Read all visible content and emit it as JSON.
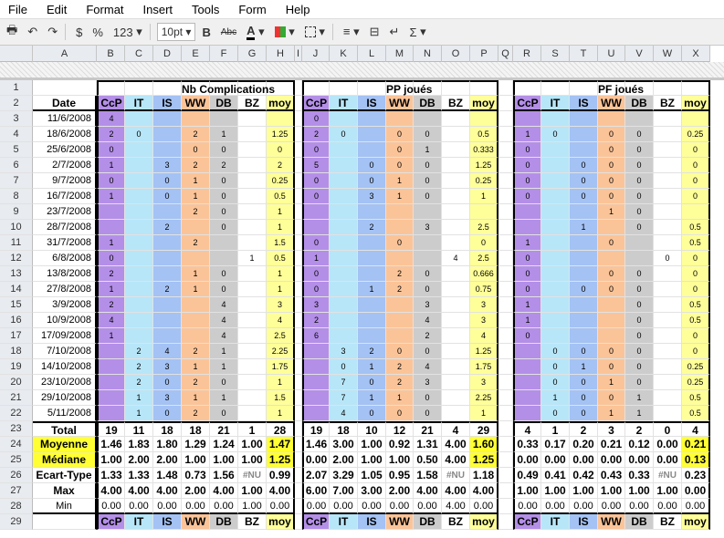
{
  "menu": [
    "File",
    "Edit",
    "Format",
    "Insert",
    "Tools",
    "Form",
    "Help"
  ],
  "toolbar": {
    "currency": "$",
    "percent": "%",
    "number_format": "123",
    "font_size": "10pt",
    "bold": "B",
    "strike": "Abc",
    "sigma": "Σ"
  },
  "columns": [
    "",
    "A",
    "B",
    "C",
    "D",
    "E",
    "F",
    "G",
    "H",
    "I",
    "J",
    "K",
    "L",
    "M",
    "N",
    "O",
    "P",
    "Q",
    "R",
    "S",
    "T",
    "U",
    "V",
    "W",
    "X"
  ],
  "sections": {
    "complications": "Nb Complications",
    "pp": "PP joués",
    "pf": "PF joués"
  },
  "headers": [
    "CcP",
    "IT",
    "IS",
    "WW",
    "DB",
    "BZ",
    "moy"
  ],
  "date_label": "Date",
  "rows": [
    {
      "n": "3",
      "date": "11/6/2008",
      "a": [
        "4",
        "",
        "",
        "",
        "",
        "",
        ""
      ],
      "b": [
        "0",
        "",
        "",
        "",
        "",
        "",
        ""
      ],
      "c": [
        "",
        "",
        "",
        "",
        "",
        "",
        ""
      ]
    },
    {
      "n": "4",
      "date": "18/6/2008",
      "a": [
        "2",
        "0",
        "",
        "2",
        "1",
        "",
        "1.25"
      ],
      "b": [
        "2",
        "0",
        "",
        "0",
        "0",
        "",
        "0.5"
      ],
      "c": [
        "1",
        "0",
        "",
        "0",
        "0",
        "",
        "0.25"
      ]
    },
    {
      "n": "5",
      "date": "25/6/2008",
      "a": [
        "0",
        "",
        "",
        "0",
        "0",
        "",
        "0"
      ],
      "b": [
        "0",
        "",
        "",
        "0",
        "1",
        "",
        "0.333"
      ],
      "c": [
        "0",
        "",
        "",
        "0",
        "0",
        "",
        "0"
      ]
    },
    {
      "n": "6",
      "date": "2/7/2008",
      "a": [
        "1",
        "",
        "3",
        "2",
        "2",
        "",
        "2"
      ],
      "b": [
        "5",
        "",
        "0",
        "0",
        "0",
        "",
        "1.25"
      ],
      "c": [
        "0",
        "",
        "0",
        "0",
        "0",
        "",
        "0"
      ]
    },
    {
      "n": "7",
      "date": "9/7/2008",
      "a": [
        "0",
        "",
        "0",
        "1",
        "0",
        "",
        "0.25"
      ],
      "b": [
        "0",
        "",
        "0",
        "1",
        "0",
        "",
        "0.25"
      ],
      "c": [
        "0",
        "",
        "0",
        "0",
        "0",
        "",
        "0"
      ]
    },
    {
      "n": "8",
      "date": "16/7/2008",
      "a": [
        "1",
        "",
        "0",
        "1",
        "0",
        "",
        "0.5"
      ],
      "b": [
        "0",
        "",
        "3",
        "1",
        "0",
        "",
        "1"
      ],
      "c": [
        "0",
        "",
        "0",
        "0",
        "0",
        "",
        "0"
      ]
    },
    {
      "n": "9",
      "date": "23/7/2008",
      "a": [
        "",
        "",
        "",
        "2",
        "0",
        "",
        "1"
      ],
      "b": [
        "",
        "",
        "",
        "",
        "",
        "",
        ""
      ],
      "c": [
        "",
        "",
        "",
        "1",
        "0",
        "",
        ""
      ]
    },
    {
      "n": "10",
      "date": "28/7/2008",
      "a": [
        "",
        "",
        "2",
        "",
        "0",
        "",
        "1"
      ],
      "b": [
        "",
        "",
        "2",
        "",
        "3",
        "",
        "2.5"
      ],
      "c": [
        "",
        "",
        "1",
        "",
        "0",
        "",
        "0.5"
      ]
    },
    {
      "n": "11",
      "date": "31/7/2008",
      "a": [
        "1",
        "",
        "",
        "2",
        "",
        "",
        "1.5"
      ],
      "b": [
        "0",
        "",
        "",
        "0",
        "",
        "",
        "0"
      ],
      "c": [
        "1",
        "",
        "",
        "0",
        "",
        "",
        "0.5"
      ]
    },
    {
      "n": "12",
      "date": "6/8/2008",
      "a": [
        "0",
        "",
        "",
        "",
        "",
        "1",
        "0.5"
      ],
      "b": [
        "1",
        "",
        "",
        "",
        "",
        "4",
        "2.5"
      ],
      "c": [
        "0",
        "",
        "",
        "",
        "",
        "0",
        "0"
      ]
    },
    {
      "n": "13",
      "date": "13/8/2008",
      "a": [
        "2",
        "",
        "",
        "1",
        "0",
        "",
        "1"
      ],
      "b": [
        "0",
        "",
        "",
        "2",
        "0",
        "",
        "0.666"
      ],
      "c": [
        "0",
        "",
        "",
        "0",
        "0",
        "",
        "0"
      ]
    },
    {
      "n": "14",
      "date": "27/8/2008",
      "a": [
        "1",
        "",
        "2",
        "1",
        "0",
        "",
        "1"
      ],
      "b": [
        "0",
        "",
        "1",
        "2",
        "0",
        "",
        "0.75"
      ],
      "c": [
        "0",
        "",
        "0",
        "0",
        "0",
        "",
        "0"
      ]
    },
    {
      "n": "15",
      "date": "3/9/2008",
      "a": [
        "2",
        "",
        "",
        "",
        "4",
        "",
        "3"
      ],
      "b": [
        "3",
        "",
        "",
        "",
        "3",
        "",
        "3"
      ],
      "c": [
        "1",
        "",
        "",
        "",
        "0",
        "",
        "0.5"
      ]
    },
    {
      "n": "16",
      "date": "10/9/2008",
      "a": [
        "4",
        "",
        "",
        "",
        "4",
        "",
        "4"
      ],
      "b": [
        "2",
        "",
        "",
        "",
        "4",
        "",
        "3"
      ],
      "c": [
        "1",
        "",
        "",
        "",
        "0",
        "",
        "0.5"
      ]
    },
    {
      "n": "17",
      "date": "17/09/2008",
      "a": [
        "1",
        "",
        "",
        "",
        "4",
        "",
        "2.5"
      ],
      "b": [
        "6",
        "",
        "",
        "",
        "2",
        "",
        "4"
      ],
      "c": [
        "0",
        "",
        "",
        "",
        "0",
        "",
        "0"
      ]
    },
    {
      "n": "18",
      "date": "7/10/2008",
      "a": [
        "",
        "2",
        "4",
        "2",
        "1",
        "",
        "2.25"
      ],
      "b": [
        "",
        "3",
        "2",
        "0",
        "0",
        "",
        "1.25"
      ],
      "c": [
        "",
        "0",
        "0",
        "0",
        "0",
        "",
        "0"
      ]
    },
    {
      "n": "19",
      "date": "14/10/2008",
      "a": [
        "",
        "2",
        "3",
        "1",
        "1",
        "",
        "1.75"
      ],
      "b": [
        "",
        "0",
        "1",
        "2",
        "4",
        "",
        "1.75"
      ],
      "c": [
        "",
        "0",
        "1",
        "0",
        "0",
        "",
        "0.25"
      ]
    },
    {
      "n": "20",
      "date": "23/10/2008",
      "a": [
        "",
        "2",
        "0",
        "2",
        "0",
        "",
        "1"
      ],
      "b": [
        "",
        "7",
        "0",
        "2",
        "3",
        "",
        "3"
      ],
      "c": [
        "",
        "0",
        "0",
        "1",
        "0",
        "",
        "0.25"
      ]
    },
    {
      "n": "21",
      "date": "29/10/2008",
      "a": [
        "",
        "1",
        "3",
        "1",
        "1",
        "",
        "1.5"
      ],
      "b": [
        "",
        "7",
        "1",
        "1",
        "0",
        "",
        "2.25"
      ],
      "c": [
        "",
        "1",
        "0",
        "0",
        "1",
        "",
        "0.5"
      ]
    },
    {
      "n": "22",
      "date": "5/11/2008",
      "a": [
        "",
        "1",
        "0",
        "2",
        "0",
        "",
        "1"
      ],
      "b": [
        "",
        "4",
        "0",
        "0",
        "0",
        "",
        "1"
      ],
      "c": [
        "",
        "0",
        "0",
        "1",
        "1",
        "",
        "0.5"
      ]
    }
  ],
  "stats": [
    {
      "n": "23",
      "label": "Total",
      "a": [
        "19",
        "11",
        "18",
        "18",
        "21",
        "1",
        "28"
      ],
      "b": [
        "19",
        "18",
        "10",
        "12",
        "21",
        "4",
        "29"
      ],
      "c": [
        "4",
        "1",
        "2",
        "3",
        "2",
        "0",
        "4"
      ]
    },
    {
      "n": "24",
      "label": "Moyenne",
      "a": [
        "1.46",
        "1.83",
        "1.80",
        "1.29",
        "1.24",
        "1.00",
        "1.47"
      ],
      "b": [
        "1.46",
        "3.00",
        "1.00",
        "0.92",
        "1.31",
        "4.00",
        "1.60"
      ],
      "c": [
        "0.33",
        "0.17",
        "0.20",
        "0.21",
        "0.12",
        "0.00",
        "0.21"
      ]
    },
    {
      "n": "25",
      "label": "Médiane",
      "a": [
        "1.00",
        "2.00",
        "2.00",
        "1.00",
        "1.00",
        "1.00",
        "1.25"
      ],
      "b": [
        "0.00",
        "2.00",
        "1.00",
        "1.00",
        "0.50",
        "4.00",
        "1.25"
      ],
      "c": [
        "0.00",
        "0.00",
        "0.00",
        "0.00",
        "0.00",
        "0.00",
        "0.13"
      ]
    },
    {
      "n": "26",
      "label": "Ecart-Type",
      "a": [
        "1.33",
        "1.33",
        "1.48",
        "0.73",
        "1.56",
        "#NU",
        "0.99"
      ],
      "b": [
        "2.07",
        "3.29",
        "1.05",
        "0.95",
        "1.58",
        "#NU",
        "1.18"
      ],
      "c": [
        "0.49",
        "0.41",
        "0.42",
        "0.43",
        "0.33",
        "#NU",
        "0.23"
      ]
    },
    {
      "n": "27",
      "label": "Max",
      "a": [
        "4.00",
        "4.00",
        "4.00",
        "2.00",
        "4.00",
        "1.00",
        "4.00"
      ],
      "b": [
        "6.00",
        "7.00",
        "3.00",
        "2.00",
        "4.00",
        "4.00",
        "4.00"
      ],
      "c": [
        "1.00",
        "1.00",
        "1.00",
        "1.00",
        "1.00",
        "1.00",
        "0.00"
      ]
    },
    {
      "n": "28",
      "label": "Min",
      "a": [
        "0.00",
        "0.00",
        "0.00",
        "0.00",
        "0.00",
        "1.00",
        "0.00"
      ],
      "b": [
        "0.00",
        "0.00",
        "0.00",
        "0.00",
        "0.00",
        "4.00",
        "0.00"
      ],
      "c": [
        "0.00",
        "0.00",
        "0.00",
        "0.00",
        "0.00",
        "0.00",
        "0.00"
      ]
    }
  ],
  "row_numbers": {
    "r1": "1",
    "r2": "2",
    "r29": "29"
  }
}
